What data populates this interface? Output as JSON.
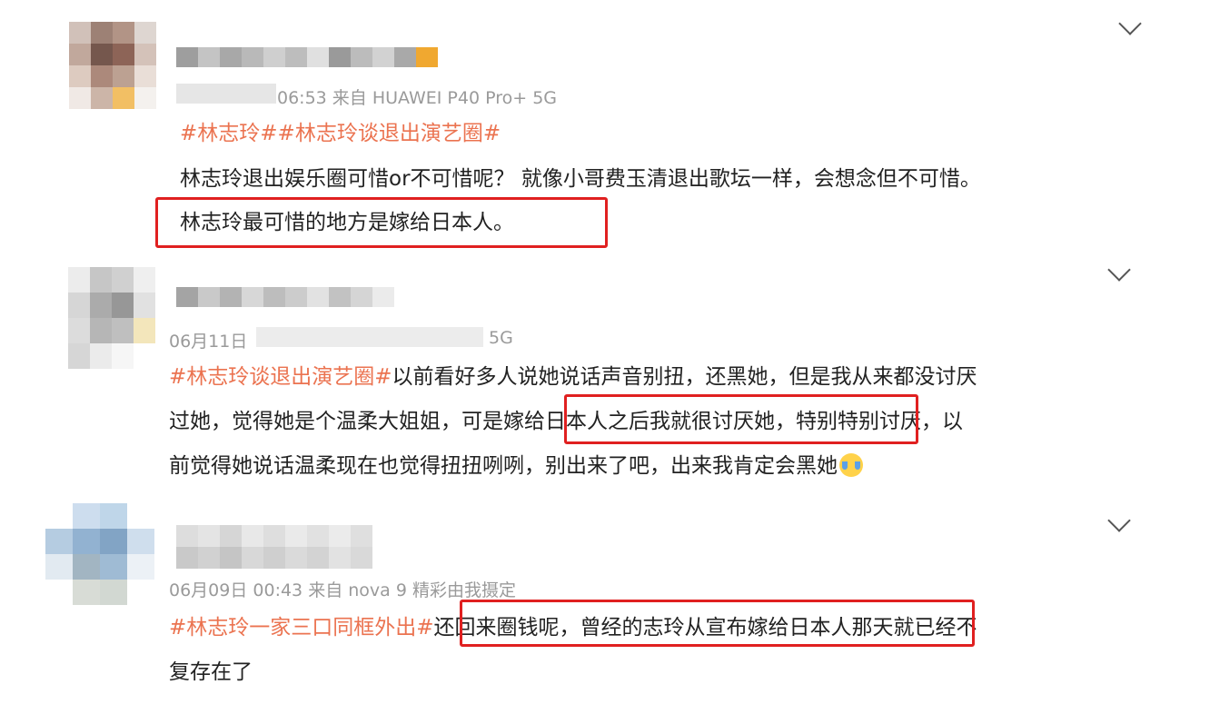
{
  "comments": [
    {
      "meta_visible": "06:53 来自 HUAWEI P40 Pro+ 5G",
      "tag": "#林志玲##林志玲谈退出演艺圈#",
      "line1": "林志玲退出娱乐圈可惜or不可惜呢？ 就像小哥费玉清退出歌坛一样，会想念但不可惜。",
      "line2": "林志玲最可惜的地方是嫁给日本人。"
    },
    {
      "meta_visible": "06月11日",
      "meta_tail": "5G",
      "tag": "#林志玲谈退出演艺圈#",
      "line1_rest": "以前看好多人说她说话声音别扭，还黑她，但是我从来都没讨厌",
      "line2": "过她，觉得她是个温柔大姐姐，可是嫁给日本人之后我就很讨厌她，特别特别讨厌，以",
      "line3": "前觉得她说话温柔现在也觉得扭扭咧咧，别出来了吧，出来我肯定会黑她",
      "emoji": "laugh-cry"
    },
    {
      "meta_visible": "06月09日 00:43 来自 nova 9 精彩由我摄定",
      "tag": "#林志玲一家三口同框外出#",
      "line1_rest": "还回来圈钱呢，曾经的志玲从宣布嫁给日本人那天就已经不",
      "line2": "复存在了"
    }
  ],
  "icons": {
    "expand": "chevron-down-icon"
  },
  "colors": {
    "tag": "#eb7350",
    "highlight": "#e02020",
    "text": "#222222",
    "meta": "#9a9a9a"
  }
}
